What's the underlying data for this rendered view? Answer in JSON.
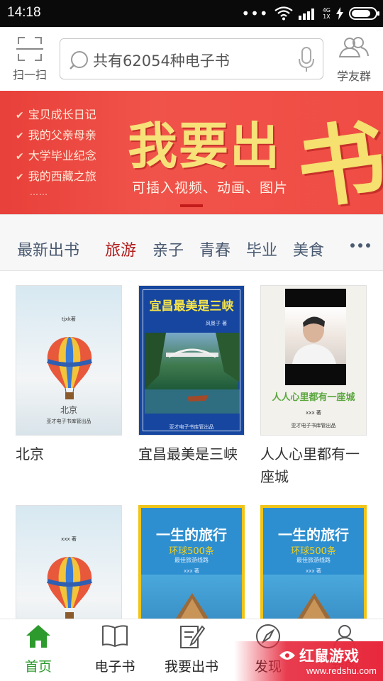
{
  "status_bar": {
    "time": "14:18",
    "dots": "•••",
    "network_top": "4G",
    "network_bottom": "1X"
  },
  "header": {
    "scan_label": "扫一扫",
    "search_placeholder": "共有62054种电子书",
    "group_label": "学友群"
  },
  "banner": {
    "items": [
      "宝贝成长日记",
      "我的父亲母亲",
      "大学毕业纪念",
      "我的西藏之旅"
    ],
    "more": "……",
    "title": "我要出",
    "title_big": "书",
    "subtitle": "可插入视频、动画、图片"
  },
  "tabs": {
    "items": [
      "最新出书",
      "旅游",
      "亲子",
      "青春",
      "毕业",
      "美食"
    ],
    "active_index": 1
  },
  "books": [
    {
      "title": "北京",
      "cover_text": "北京",
      "cover_small": "tjxk著",
      "cover_publisher": "亚才电子书库管出品"
    },
    {
      "title": "宜昌最美是三峡",
      "cover_text": "宜昌最美是三峡",
      "cover_small": "风景子 著",
      "cover_publisher": "亚才电子书库管出品"
    },
    {
      "title": "人人心里都有一座城",
      "cover_text": "人人心里都有一座城",
      "cover_small": "xxx 著",
      "cover_publisher": "亚才电子书库管出品"
    },
    {
      "title": "",
      "cover_small": "xxx 著"
    },
    {
      "title": "",
      "cover_text": "一生的旅行",
      "cover_sub": "环球500条",
      "cover_sub2": "最佳旅游线路",
      "cover_small": "xxx 著"
    },
    {
      "title": "",
      "cover_text": "一生的旅行",
      "cover_sub": "环球500条",
      "cover_sub2": "最佳旅游线路",
      "cover_small": "xxx 著"
    }
  ],
  "bottom_nav": {
    "items": [
      "首页",
      "电子书",
      "我要出书",
      "发现",
      "我的"
    ],
    "active_index": 0
  },
  "watermark": {
    "text": "红鼠游戏",
    "url": "www.redshu.com"
  },
  "colors": {
    "banner_red": "#ef4c44",
    "active_tab": "#b01c1c",
    "active_nav": "#2c9a2c",
    "banner_text": "#f7e27a"
  }
}
